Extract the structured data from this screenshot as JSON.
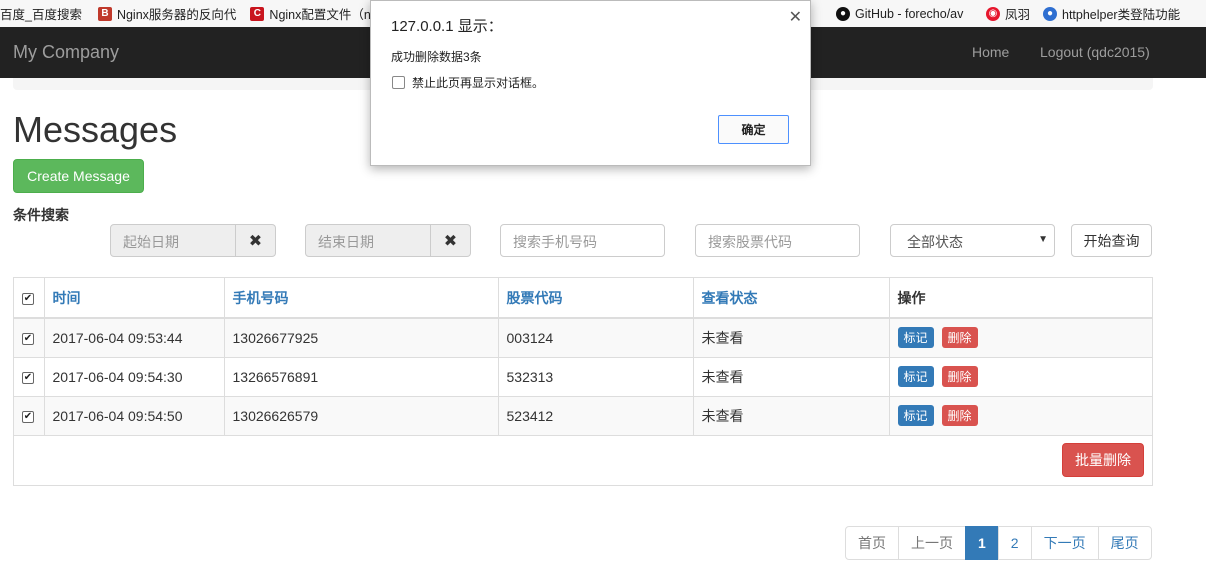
{
  "bookmarks": [
    {
      "label": "百度_百度搜索",
      "icon": "baidu-icon"
    },
    {
      "label": "Nginx服务器的反向代",
      "icon": "nginx-b-icon",
      "color": "#c0392b"
    },
    {
      "label": "Nginx配置文件（ngi",
      "icon": "csdn-icon",
      "color": "#c9151e"
    },
    {
      "label": "GitHub - forecho/av",
      "icon": "github-icon",
      "color": "#111"
    },
    {
      "label": "凤羽",
      "icon": "weibo-icon",
      "color": "#e6162d"
    },
    {
      "label": "httphelper类登陆功能",
      "icon": "cnblogs-icon",
      "color": "#2f6fd1"
    }
  ],
  "navbar": {
    "brand": "My Company",
    "links": [
      "Home",
      "Logout (qdc2015)"
    ]
  },
  "page": {
    "title": "Messages",
    "create_button": "Create Message",
    "search_label": "条件搜索"
  },
  "filters": {
    "start_date": "起始日期",
    "end_date": "结束日期",
    "clear_icon": "✖",
    "phone_placeholder": "搜索手机号码",
    "stock_placeholder": "搜索股票代码",
    "status_selected": "全部状态",
    "query_button": "开始查询"
  },
  "table": {
    "headers": [
      "时间",
      "手机号码",
      "股票代码",
      "查看状态",
      "操作"
    ],
    "rows": [
      {
        "time": "2017-06-04 09:53:44",
        "phone": "13026677925",
        "stock": "003124",
        "status": "未查看",
        "checked": true
      },
      {
        "time": "2017-06-04 09:54:30",
        "phone": "13266576891",
        "stock": "532313",
        "status": "未查看",
        "checked": true
      },
      {
        "time": "2017-06-04 09:54:50",
        "phone": "13026626579",
        "stock": "523412",
        "status": "未查看",
        "checked": true
      }
    ],
    "mark_label": "标记",
    "delete_label": "删除",
    "batch_delete": "批量删除"
  },
  "pagination": [
    "首页",
    "上一页",
    "1",
    "2",
    "下一页",
    "尾页"
  ],
  "dialog": {
    "title": "127.0.0.1 显示：",
    "message": "成功删除数据3条",
    "checkbox_label": "禁止此页再显示对话框。",
    "ok_button": "确定"
  },
  "colors": {
    "navbar": "#222222",
    "primary": "#337ab7",
    "success": "#5cb85c",
    "danger": "#d9534f"
  }
}
